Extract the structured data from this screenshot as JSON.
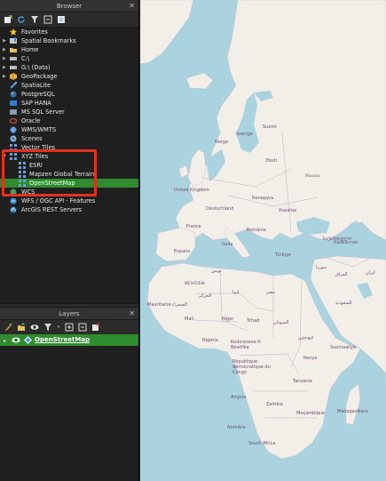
{
  "browser": {
    "title": "Browser",
    "close": "✕",
    "tree": [
      {
        "label": "Favorites",
        "icon": "star-icon"
      },
      {
        "label": "Spatial Bookmarks",
        "icon": "bookmark-icon"
      },
      {
        "label": "Home",
        "icon": "folder-icon"
      },
      {
        "label": "C:\\",
        "icon": "drive-icon"
      },
      {
        "label": "G:\\ (Data)",
        "icon": "drive-icon"
      },
      {
        "label": "GeoPackage",
        "icon": "geopackage-icon"
      },
      {
        "label": "SpatiaLite",
        "icon": "spatialite-icon"
      },
      {
        "label": "PostgreSQL",
        "icon": "postgresql-icon"
      },
      {
        "label": "SAP HANA",
        "icon": "saphana-icon"
      },
      {
        "label": "MS SQL Server",
        "icon": "mssql-icon"
      },
      {
        "label": "Oracle",
        "icon": "oracle-icon"
      },
      {
        "label": "WMS/WMTS",
        "icon": "wms-icon"
      },
      {
        "label": "Scenes",
        "icon": "scenes-icon"
      },
      {
        "label": "Vector Tiles",
        "icon": "vector-tiles-icon"
      },
      {
        "label": "XYZ Tiles",
        "icon": "xyz-tiles-icon"
      },
      {
        "label": "ESRI",
        "icon": "tile-grid-icon"
      },
      {
        "label": "Mapzen Global Terrain",
        "icon": "tile-grid-icon"
      },
      {
        "label": "OpenStreetMap",
        "icon": "tile-grid-icon"
      },
      {
        "label": "WCS",
        "icon": "wcs-icon"
      },
      {
        "label": "WFS / OGC API - Features",
        "icon": "wfs-icon"
      },
      {
        "label": "ArcGIS REST Servers",
        "icon": "arcgis-icon"
      }
    ]
  },
  "layers": {
    "title": "Layers",
    "close": "✕",
    "items": [
      {
        "label": "OpenStreetMap",
        "visible": true
      }
    ]
  },
  "map": {
    "labels": {
      "norge": "Norge",
      "sverige": "Sverige",
      "suomi": "Suomi",
      "eesti": "Eesti",
      "united_kingdom": "United Kingdom",
      "deutschland": "Deutschland",
      "belarus": "Беларусь",
      "ukraine": "Україна",
      "france": "France",
      "romania": "România",
      "italia": "Italia",
      "espana": "España",
      "turkiye": "Türkiye",
      "sakartvelo": "საქართველო",
      "libya": "ليبيا",
      "egypt": "مصر",
      "iraq": "العراق",
      "syria": "سوريا",
      "iran": "ایران",
      "saudi": "السعودية",
      "tunisia": "تونس",
      "algeria": "الجزائر",
      "morocco": "ⵍⵎⵖⵔⵉⴱ",
      "mauritanie": "Mauritanie",
      "mali": "Mali",
      "niger": "Niger",
      "tchad": "Tchad",
      "sudan": "السودان",
      "nigeria": "Nigeria",
      "ethiopia": "ኢትዮጵያ",
      "somalia": "Soomaaliya",
      "kodorosese": "Kodorosese tî Bêafrîka",
      "kenya": "Kenya",
      "republique": "République démocratique du Congo",
      "tanzania": "Tanzania",
      "angola": "Angola",
      "zambia": "Zambia",
      "namibia": "Namibia",
      "mocambique": "Moçambique",
      "madagasikara": "Madagasikara",
      "south_africa": "South Africa",
      "kazakhstan": "Казахстан",
      "russia_city": "Москва",
      "sahara": "الصحراء"
    }
  }
}
